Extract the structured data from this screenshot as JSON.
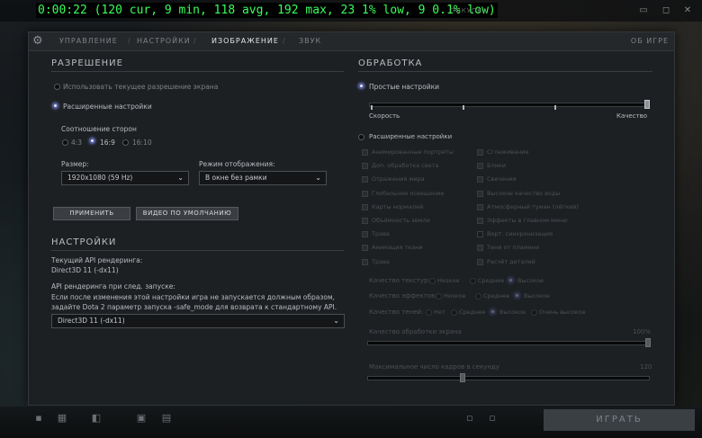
{
  "fps_overlay": "0:00:22 (120 cur, 9 min, 118 avg, 192 max, 23 1% low, 9 0.1% low)",
  "tabs": [
    "УПРАВЛЕНИЕ",
    "НАСТРОЙКИ",
    "ИЗОБРАЖЕНИЕ",
    "ЗВУК"
  ],
  "active_tab": "ИЗОБРАЖЕНИЕ",
  "exit_label": "ОБ ИГРЕ",
  "resolution": {
    "heading": "РАЗРЕШЕНИЕ",
    "use_current": "Использовать текущее разрешение экрана",
    "advanced": "Расширенные настройки",
    "aspect_label": "Соотношение сторон",
    "aspect_options": [
      "4:3",
      "16:9",
      "16:10"
    ],
    "aspect_selected": "16:9",
    "size_label": "Размер:",
    "size_value": "1920x1080 (59 Hz)",
    "mode_label": "Режим отображения:",
    "mode_value": "В окне без рамки",
    "apply_button": "ПРИМЕНИТЬ",
    "default_button": "ВИДЕО ПО УМОЛЧАНИЮ"
  },
  "settings": {
    "heading": "НАСТРОЙКИ",
    "current_api_label": "Текущий API рендеринга:",
    "current_api_value": "Direct3D 11 (-dx11)",
    "next_api_label": "API рендеринга при след. запуске:",
    "warning_line1": "Если после изменения этой настройки игра не запускается должным образом,",
    "warning_line2": "задайте Dota 2 параметр запуска -safe_mode для возврата к стандартному API.",
    "api_select_value": "Direct3D 11 (-dx11)"
  },
  "processing": {
    "heading": "ОБРАБОТКА",
    "simple": "Простые настройки",
    "simple_selected": true,
    "quality_slider_value": 1.0,
    "speed_label": "Скорость",
    "quality_label": "Качество",
    "advanced": "Расширенные настройки",
    "checkboxes_left": [
      "Анимированные портреты",
      "Доп. обработка света",
      "Отражения мира",
      "Глобальное освещение",
      "Карты нормалей",
      "Объёмность земли",
      "Трава",
      "Анимация ткани",
      "Трава"
    ],
    "checkboxes_right": [
      "Сглаживание",
      "Блики",
      "Свечения",
      "Высокое качество воды",
      "Атмосферный туман (лёгкий)",
      "Эффекты в главном меню",
      "Верт. синхронизация",
      "Тени от пламени",
      "Расчёт деталей"
    ],
    "texture_label": "Качество текстур:",
    "texture_options": [
      "Низкое",
      "Среднее",
      "Высокое"
    ],
    "effects_label": "Качество эффектов:",
    "effects_options": [
      "Низкое",
      "Среднее",
      "Высокое"
    ],
    "shadow_label": "Качество теней:",
    "shadow_options": [
      "Нет",
      "Среднее",
      "Высокое",
      "Очень высокое"
    ],
    "render_quality_label": "Качество обработки экрана",
    "render_quality_value": "100%",
    "fps_label": "Максимальное число кадров в секунду",
    "fps_value": "120"
  },
  "bottom": {
    "play": "ИГРАТЬ"
  }
}
